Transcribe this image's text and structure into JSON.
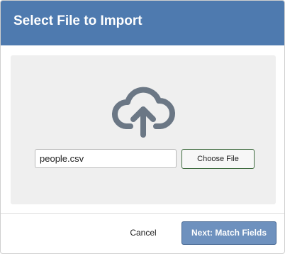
{
  "dialog": {
    "title": "Select File to Import"
  },
  "upload": {
    "icon": "cloud-upload-icon",
    "icon_color": "#6b7785",
    "file_name": "people.csv",
    "choose_label": "Choose File"
  },
  "footer": {
    "cancel_label": "Cancel",
    "next_label": "Next: Match Fields"
  },
  "colors": {
    "header": "#4e7aaf",
    "primary_button": "#6e91be",
    "dropzone": "#efefef"
  }
}
